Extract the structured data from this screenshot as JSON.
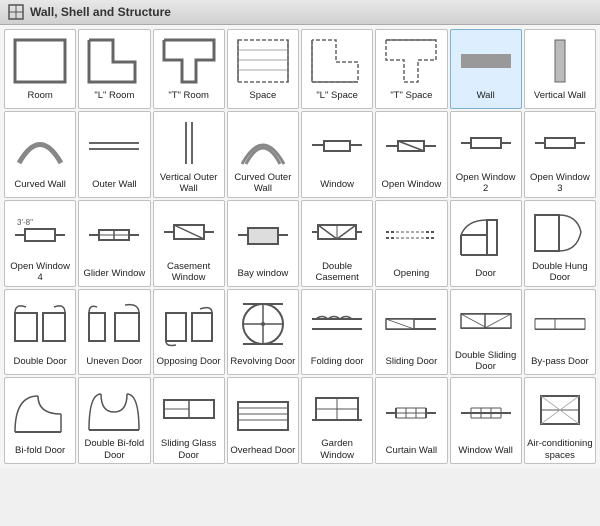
{
  "titleBar": {
    "icon": "wall-icon",
    "title": "Wall, Shell and Structure"
  },
  "items": [
    {
      "id": "room",
      "label": "Room",
      "svgKey": "room"
    },
    {
      "id": "l-room",
      "label": "\"L\" Room",
      "svgKey": "l-room"
    },
    {
      "id": "t-room",
      "label": "\"T\" Room",
      "svgKey": "t-room"
    },
    {
      "id": "space",
      "label": "Space",
      "svgKey": "space"
    },
    {
      "id": "l-space",
      "label": "\"L\" Space",
      "svgKey": "l-space"
    },
    {
      "id": "t-space",
      "label": "\"T\" Space",
      "svgKey": "t-space"
    },
    {
      "id": "wall",
      "label": "Wall",
      "svgKey": "wall"
    },
    {
      "id": "vertical-wall",
      "label": "Vertical Wall",
      "svgKey": "vertical-wall"
    },
    {
      "id": "curved-wall",
      "label": "Curved Wall",
      "svgKey": "curved-wall"
    },
    {
      "id": "outer-wall",
      "label": "Outer Wall",
      "svgKey": "outer-wall"
    },
    {
      "id": "vertical-outer-wall",
      "label": "Vertical Outer Wall",
      "svgKey": "vertical-outer-wall"
    },
    {
      "id": "curved-outer-wall",
      "label": "Curved Outer Wall",
      "svgKey": "curved-outer-wall"
    },
    {
      "id": "window",
      "label": "Window",
      "svgKey": "window"
    },
    {
      "id": "open-window",
      "label": "Open Window",
      "svgKey": "open-window"
    },
    {
      "id": "open-window-2",
      "label": "Open Window 2",
      "svgKey": "open-window-2"
    },
    {
      "id": "open-window-3",
      "label": "Open Window 3",
      "svgKey": "open-window-3"
    },
    {
      "id": "open-window-4",
      "label": "Open Window 4",
      "svgKey": "open-window-4"
    },
    {
      "id": "glider-window",
      "label": "Glider Window",
      "svgKey": "glider-window"
    },
    {
      "id": "casement-window",
      "label": "Casement Window",
      "svgKey": "casement-window"
    },
    {
      "id": "bay-window",
      "label": "Bay window",
      "svgKey": "bay-window"
    },
    {
      "id": "double-casement",
      "label": "Double Casement",
      "svgKey": "double-casement"
    },
    {
      "id": "opening",
      "label": "Opening",
      "svgKey": "opening"
    },
    {
      "id": "door",
      "label": "Door",
      "svgKey": "door"
    },
    {
      "id": "double-hung-door",
      "label": "Double Hung Door",
      "svgKey": "double-hung-door"
    },
    {
      "id": "double-door",
      "label": "Double Door",
      "svgKey": "double-door"
    },
    {
      "id": "uneven-door",
      "label": "Uneven Door",
      "svgKey": "uneven-door"
    },
    {
      "id": "opposing-door",
      "label": "Opposing Door",
      "svgKey": "opposing-door"
    },
    {
      "id": "revolving-door",
      "label": "Revolving Door",
      "svgKey": "revolving-door"
    },
    {
      "id": "folding-door",
      "label": "Folding door",
      "svgKey": "folding-door"
    },
    {
      "id": "sliding-door",
      "label": "Sliding Door",
      "svgKey": "sliding-door"
    },
    {
      "id": "double-sliding-door",
      "label": "Double Sliding Door",
      "svgKey": "double-sliding-door"
    },
    {
      "id": "by-pass-door",
      "label": "By-pass Door",
      "svgKey": "by-pass-door"
    },
    {
      "id": "bi-fold-door",
      "label": "Bi-fold Door",
      "svgKey": "bi-fold-door"
    },
    {
      "id": "double-bi-fold-door",
      "label": "Double Bi-fold Door",
      "svgKey": "double-bi-fold-door"
    },
    {
      "id": "sliding-glass-door",
      "label": "Sliding Glass Door",
      "svgKey": "sliding-glass-door"
    },
    {
      "id": "overhead-door",
      "label": "Overhead Door",
      "svgKey": "overhead-door"
    },
    {
      "id": "garden-window",
      "label": "Garden Window",
      "svgKey": "garden-window"
    },
    {
      "id": "curtain-wall",
      "label": "Curtain Wall",
      "svgKey": "curtain-wall"
    },
    {
      "id": "window-wall",
      "label": "Window Wall",
      "svgKey": "window-wall"
    },
    {
      "id": "air-conditioning-spaces",
      "label": "Air-conditioning spaces",
      "svgKey": "air-conditioning-spaces"
    }
  ]
}
